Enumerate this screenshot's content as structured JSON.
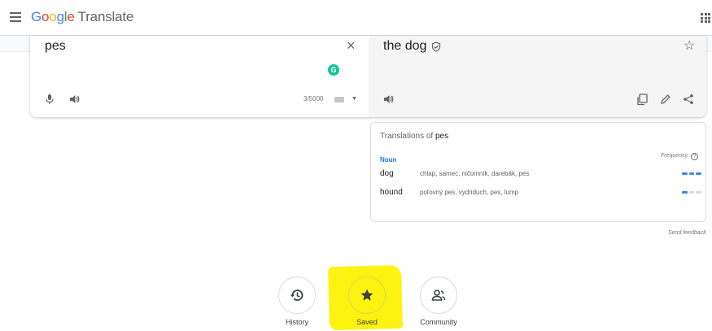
{
  "header": {
    "logo": [
      "G",
      "o",
      "o",
      "g",
      "l",
      "e"
    ],
    "product": "Translate"
  },
  "source": {
    "text": "pes",
    "char_count": "3/5000",
    "close_glyph": "×"
  },
  "target": {
    "text": "the dog",
    "star_glyph": "☆"
  },
  "dictionary": {
    "title_prefix": "Translations of",
    "title_word": "pes",
    "part_of_speech": "Noun",
    "frequency_label": "Frequency",
    "frequency_help": "?",
    "entries": [
      {
        "word": "dog",
        "synonyms": "chlap, samec, ničomník, darebák, pes",
        "frequency": 3
      },
      {
        "word": "hound",
        "synonyms": "poľovný pes, vydriduch, pes, lump",
        "frequency": 1
      }
    ]
  },
  "feedback_link": "Send feedback",
  "shortcuts": [
    {
      "label": "History",
      "icon": "history-icon"
    },
    {
      "label": "Saved",
      "icon": "star-icon",
      "highlighted": true
    },
    {
      "label": "Community",
      "icon": "community-icon"
    }
  ],
  "colors": {
    "accent": "#1a73e8",
    "frequency_bar": "#4285f4",
    "highlight": "#fdf311",
    "grammarly": "#15c39a"
  }
}
